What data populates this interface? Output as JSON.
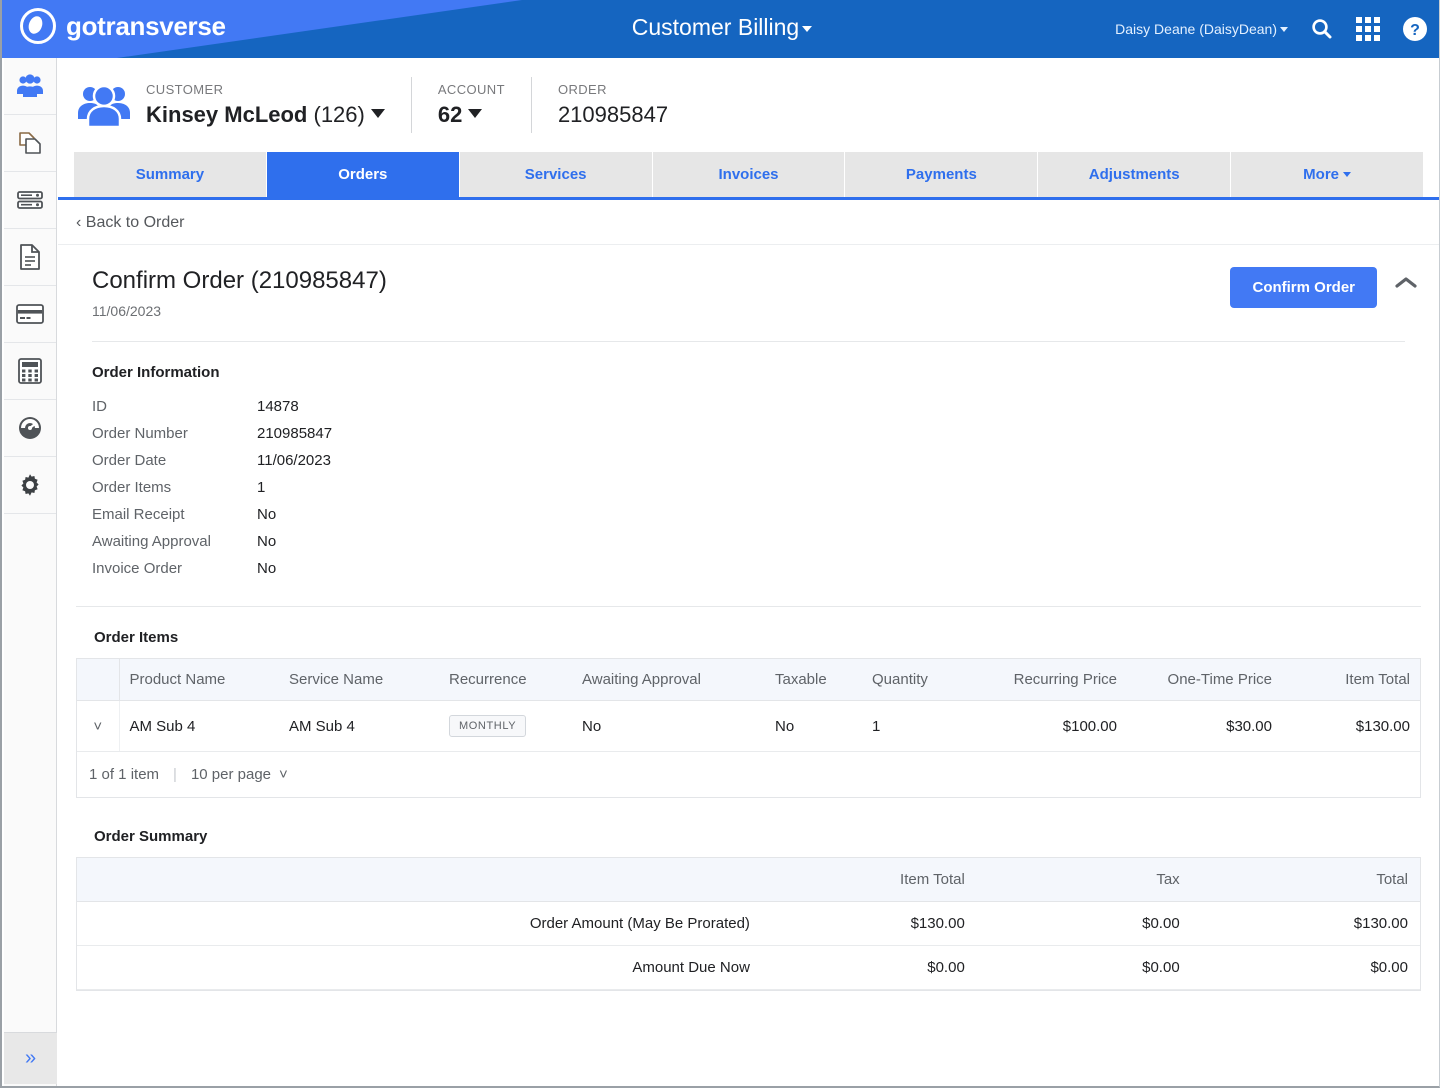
{
  "header": {
    "brand": "gotransverse",
    "app_title": "Customer Billing",
    "user": "Daisy Deane (DaisyDean)",
    "icons": [
      "search-icon",
      "apps-grid-icon",
      "help-icon"
    ],
    "colors": {
      "light_blue": "#4279f4",
      "dark_blue": "#1565c0"
    }
  },
  "sidebar": {
    "items": [
      {
        "name": "customers-icon",
        "label": "Customers"
      },
      {
        "name": "copy-documents-icon",
        "label": "Products"
      },
      {
        "name": "server-list-icon",
        "label": "Services"
      },
      {
        "name": "document-icon",
        "label": "Invoices"
      },
      {
        "name": "credit-card-icon",
        "label": "Payments"
      },
      {
        "name": "calculator-icon",
        "label": "Billing"
      },
      {
        "name": "gauge-icon",
        "label": "Dashboard"
      },
      {
        "name": "gear-icon",
        "label": "Settings"
      }
    ],
    "expand_label": "»"
  },
  "entity_bar": {
    "customer_label": "CUSTOMER",
    "customer_name": "Kinsey McLeod",
    "customer_id": "(126)",
    "account_label": "ACCOUNT",
    "account_value": "62",
    "order_label": "ORDER",
    "order_value": "210985847"
  },
  "tabs": [
    {
      "label": "Summary",
      "active": false
    },
    {
      "label": "Orders",
      "active": true
    },
    {
      "label": "Services",
      "active": false
    },
    {
      "label": "Invoices",
      "active": false
    },
    {
      "label": "Payments",
      "active": false
    },
    {
      "label": "Adjustments",
      "active": false
    },
    {
      "label": "More",
      "active": false,
      "caret": true
    }
  ],
  "back_link": "Back to Order",
  "page": {
    "title": "Confirm Order (210985847)",
    "date": "11/06/2023",
    "confirm_button": "Confirm Order"
  },
  "order_information": {
    "title": "Order Information",
    "rows": [
      {
        "key": "ID",
        "value": "14878"
      },
      {
        "key": "Order Number",
        "value": "210985847"
      },
      {
        "key": "Order Date",
        "value": "11/06/2023"
      },
      {
        "key": "Order Items",
        "value": "1"
      },
      {
        "key": "Email Receipt",
        "value": "No"
      },
      {
        "key": "Awaiting Approval",
        "value": "No"
      },
      {
        "key": "Invoice Order",
        "value": "No"
      }
    ]
  },
  "order_items": {
    "title": "Order Items",
    "columns": [
      "Product Name",
      "Service Name",
      "Recurrence",
      "Awaiting Approval",
      "Taxable",
      "Quantity",
      "Recurring Price",
      "One-Time Price",
      "Item Total"
    ],
    "rows": [
      {
        "product_name": "AM Sub 4",
        "service_name": "AM Sub 4",
        "recurrence": "MONTHLY",
        "awaiting_approval": "No",
        "taxable": "No",
        "quantity": "1",
        "recurring_price": "$100.00",
        "one_time_price": "$30.00",
        "item_total": "$130.00"
      }
    ],
    "footer": {
      "count": "1 of 1 item",
      "per_page": "10 per page"
    }
  },
  "order_summary": {
    "title": "Order Summary",
    "columns": [
      "",
      "Item Total",
      "Tax",
      "Total"
    ],
    "rows": [
      {
        "label": "Order Amount (May Be Prorated)",
        "item_total": "$130.00",
        "tax": "$0.00",
        "total": "$130.00"
      },
      {
        "label": "Amount Due Now",
        "item_total": "$0.00",
        "tax": "$0.00",
        "total": "$0.00"
      }
    ]
  }
}
